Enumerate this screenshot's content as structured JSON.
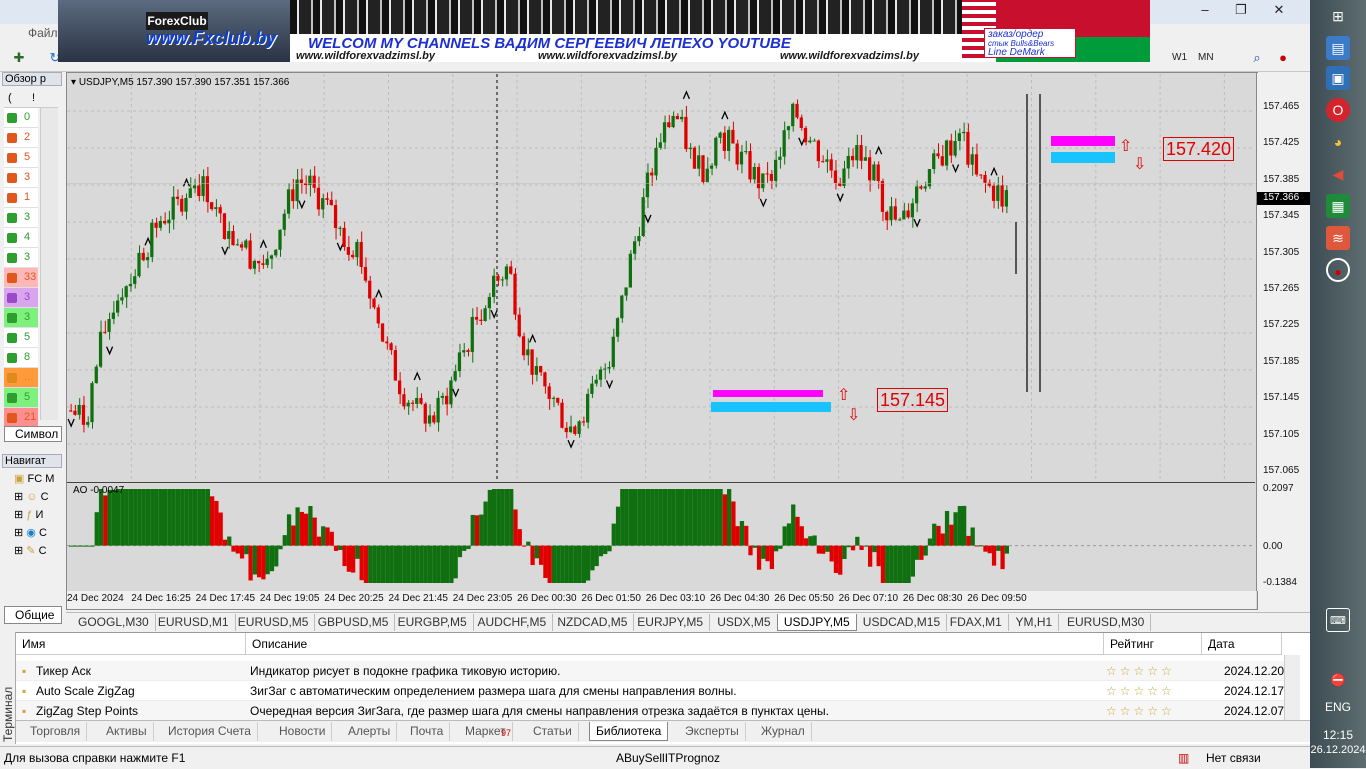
{
  "app": {
    "menu_file": "Файл",
    "window_controls": [
      "–",
      "❐",
      "✕"
    ]
  },
  "toolbar": {
    "timeframes": [
      "W1",
      "MN"
    ]
  },
  "banner": {
    "brand": "ForexClub",
    "site": "www.Fxclub.by",
    "welcome": "WELCOM MY CHANNELS ВАДИМ СЕРГЕЕВИЧ ЛЕПЕХО YOUTUBE",
    "links": [
      "www.wildforexvadzimsl.by",
      "www.wildforexvadzimsl.by",
      "www.wildforexvadzimsl.by"
    ],
    "order_lines": [
      "заказ/ордер",
      "стык Bulls&Bears",
      "Line DeMark"
    ]
  },
  "market_watch": {
    "header": "Обзор р",
    "cols": [
      "(",
      "!"
    ],
    "rows": [
      {
        "val": "0",
        "color": "#2e9e2e",
        "bg": "#fff"
      },
      {
        "val": "2",
        "color": "#e0581c",
        "bg": "#fff"
      },
      {
        "val": "5",
        "color": "#e0581c",
        "bg": "#fff"
      },
      {
        "val": "3",
        "color": "#e0581c",
        "bg": "#fff"
      },
      {
        "val": "1",
        "color": "#e0581c",
        "bg": "#fff"
      },
      {
        "val": "3",
        "color": "#2e9e2e",
        "bg": "#fff"
      },
      {
        "val": "4",
        "color": "#2e9e2e",
        "bg": "#fff"
      },
      {
        "val": "3",
        "color": "#2e9e2e",
        "bg": "#fff"
      },
      {
        "val": "33",
        "color": "#e0581c",
        "bg": "#ffb7b7"
      },
      {
        "val": "3",
        "color": "#9a49c9",
        "bg": "#d9a6ee"
      },
      {
        "val": "3",
        "color": "#2e9e2e",
        "bg": "#7ef07e"
      },
      {
        "val": "5",
        "color": "#2e9e2e",
        "bg": "#fff"
      },
      {
        "val": "8",
        "color": "#2e9e2e",
        "bg": "#fff"
      },
      {
        "val": "...",
        "color": "#e08a1c",
        "bg": "#ff9a3c"
      },
      {
        "val": "5",
        "color": "#2e9e2e",
        "bg": "#7ef07e"
      },
      {
        "val": "21",
        "color": "#e0581c",
        "bg": "#ff8f8f"
      }
    ],
    "tab": "Символ"
  },
  "navigator": {
    "header": "Навигат",
    "items": [
      "FC M",
      "С",
      "И",
      "С",
      "С"
    ],
    "tab": "Общие"
  },
  "chart": {
    "header": "USDJPY,M5  157.390 157.390 157.351 157.366",
    "current_price": "157.366",
    "price_labels": [
      "157.465",
      "157.425",
      "157.385",
      "157.345",
      "157.305",
      "157.265",
      "157.225",
      "157.185",
      "157.145",
      "157.105",
      "157.065"
    ],
    "level_high": "157.420",
    "level_low": "157.145",
    "colors": {
      "bull": "#107010",
      "bear": "#e00000",
      "bg": "#d9d9d9",
      "magenta": "#ff00ff",
      "cyan": "#19c3ff"
    },
    "ao_label": "AO -0.0047",
    "ao_scale": [
      "0.2097",
      "0.00",
      "-0.1384"
    ],
    "time_labels": [
      "24 Dec 2024",
      "24 Dec 16:25",
      "24 Dec 17:45",
      "24 Dec 19:05",
      "24 Dec 20:25",
      "24 Dec 21:45",
      "24 Dec 23:05",
      "26 Dec 00:30",
      "26 Dec 01:50",
      "26 Dec 03:10",
      "26 Dec 04:30",
      "26 Dec 05:50",
      "26 Dec 07:10",
      "26 Dec 08:30",
      "26 Dec 09:50"
    ]
  },
  "chart_data": {
    "type": "candlestick",
    "symbol": "USDJPY",
    "timeframe": "M5",
    "ylim": [
      157.065,
      157.465
    ],
    "ohlc_last": {
      "open": 157.39,
      "high": 157.39,
      "low": 157.351,
      "close": 157.366
    },
    "close_path": [
      157.13,
      157.12,
      157.2,
      157.25,
      157.27,
      157.3,
      157.33,
      157.34,
      157.37,
      157.36,
      157.32,
      157.31,
      157.29,
      157.28,
      157.33,
      157.37,
      157.36,
      157.34,
      157.31,
      157.3,
      157.24,
      157.19,
      157.15,
      157.13,
      157.12,
      157.15,
      157.19,
      157.23,
      157.26,
      157.28,
      157.2,
      157.16,
      157.14,
      157.11,
      157.13,
      157.16,
      157.2,
      157.28,
      157.35,
      157.41,
      157.44,
      157.4,
      157.38,
      157.42,
      157.4,
      157.38,
      157.36,
      157.4,
      157.44,
      157.41,
      157.39,
      157.37,
      157.4,
      157.38,
      157.34,
      157.32,
      157.36,
      157.38,
      157.4,
      157.42,
      157.37,
      157.36,
      157.35
    ],
    "ao_range": [
      -0.1384,
      0.2097
    ],
    "ao_last": -0.0047
  },
  "symbol_tabs": [
    "GOOGL,M30",
    "EURUSD,M1",
    "EURUSD,M5",
    "GBPUSD,M5",
    "EURGBP,M5",
    "AUDCHF,M5",
    "NZDCAD,M5",
    "EURJPY,M5",
    "USDX,M5",
    "USDJPY,M5",
    "USDCAD,M15",
    "FDAX,M1",
    "YM,H1",
    "EURUSD,M30"
  ],
  "symbol_tab_active": "USDJPY,M5",
  "terminal": {
    "side_label": "Терминал",
    "headers": [
      "Имя",
      "Описание",
      "Рейтинг",
      "Дата"
    ],
    "rows": [
      {
        "name": "Тикер Аск",
        "desc": "Индикатор рисует в подокне графика тиковую историю.",
        "rating": "☆☆☆☆☆",
        "date": "2024.12.20"
      },
      {
        "name": "Auto Scale ZigZag",
        "desc": "ЗигЗаг с автоматическим определением размера шага для смены направления волны.",
        "rating": "☆☆☆☆☆",
        "date": "2024.12.17"
      },
      {
        "name": "ZigZag Step Points",
        "desc": "Очередная версия ЗигЗага, где размер шага для смены направления отрезка задаётся в пунктах цены.",
        "rating": "☆☆☆☆☆",
        "date": "2024.12.07"
      }
    ],
    "tabs": [
      "Торговля",
      "Активы",
      "История Счета",
      "Новости",
      "Алерты",
      "Почта",
      "Маркет",
      "Статьи",
      "Библиотека",
      "Эксперты",
      "Журнал"
    ],
    "market_badge": "97",
    "active_tab": "Библиотека"
  },
  "status": {
    "help": "Для вызова справки нажмите F1",
    "profile": "ABuySellITPrognoz",
    "connection": "Нет связи"
  },
  "taskbar": {
    "lang": "ENG",
    "time": "12:15",
    "date": "26.12.2024"
  }
}
